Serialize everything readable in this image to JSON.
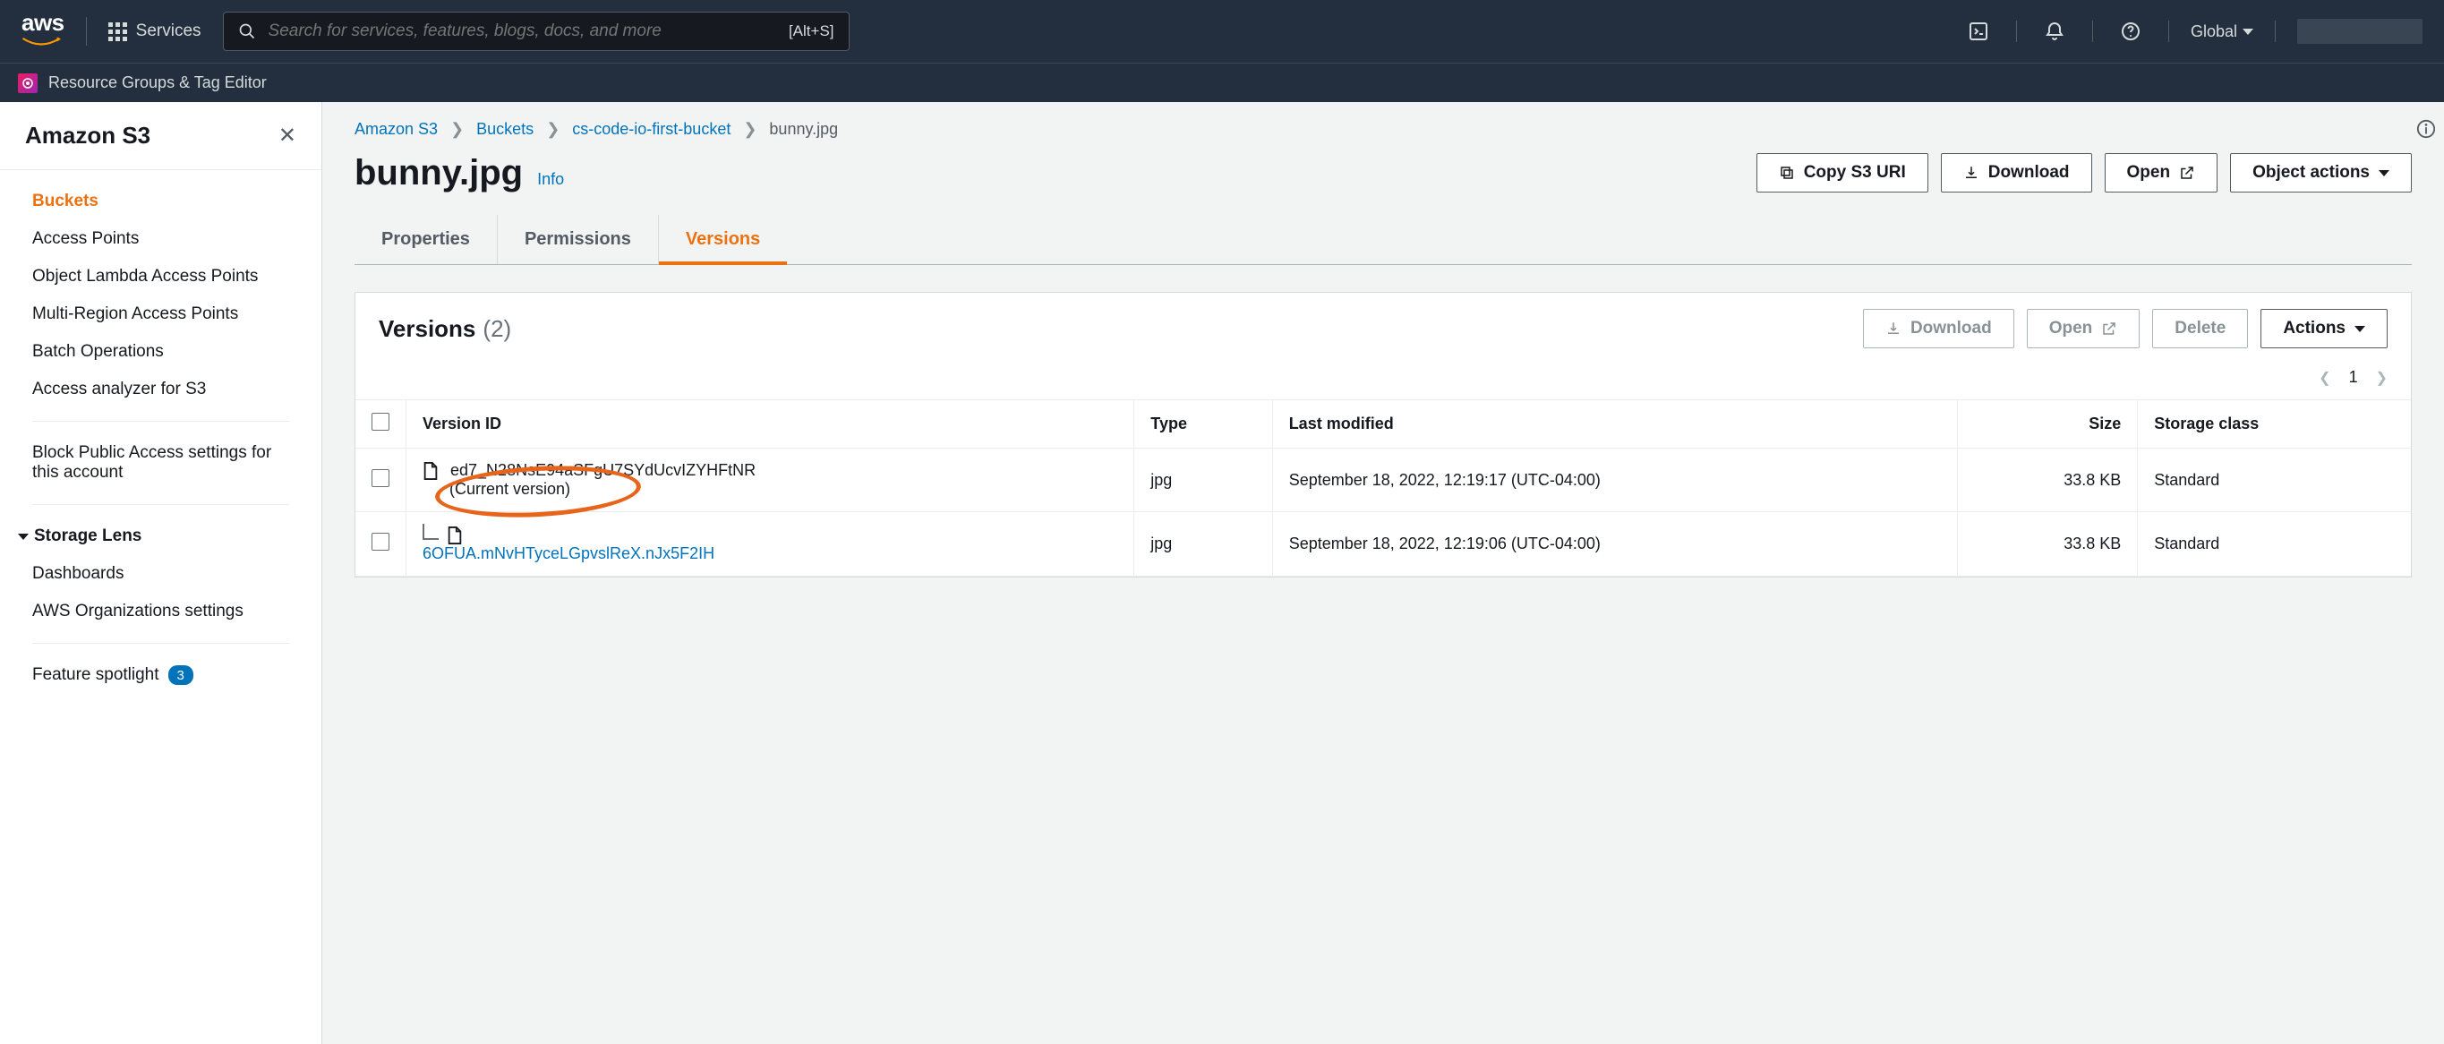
{
  "topnav": {
    "services_label": "Services",
    "search_placeholder": "Search for services, features, blogs, docs, and more",
    "search_kbd": "[Alt+S]",
    "region": "Global"
  },
  "subbar": {
    "label": "Resource Groups & Tag Editor"
  },
  "sidebar": {
    "title": "Amazon S3",
    "items": [
      {
        "label": "Buckets",
        "active": true
      },
      {
        "label": "Access Points"
      },
      {
        "label": "Object Lambda Access Points"
      },
      {
        "label": "Multi-Region Access Points"
      },
      {
        "label": "Batch Operations"
      },
      {
        "label": "Access analyzer for S3"
      }
    ],
    "block_public": "Block Public Access settings for this account",
    "storage_lens": "Storage Lens",
    "lens_items": [
      {
        "label": "Dashboards"
      },
      {
        "label": "AWS Organizations settings"
      }
    ],
    "feature_spotlight": "Feature spotlight",
    "feature_badge": "3"
  },
  "breadcrumb": {
    "items": [
      {
        "label": "Amazon S3",
        "link": true
      },
      {
        "label": "Buckets",
        "link": true
      },
      {
        "label": "cs-code-io-first-bucket",
        "link": true
      },
      {
        "label": "bunny.jpg",
        "link": false
      }
    ]
  },
  "page": {
    "title": "bunny.jpg",
    "info": "Info",
    "buttons": {
      "copy_uri": "Copy S3 URI",
      "download": "Download",
      "open": "Open",
      "object_actions": "Object actions"
    }
  },
  "tabs": [
    {
      "label": "Properties",
      "active": false
    },
    {
      "label": "Permissions",
      "active": false
    },
    {
      "label": "Versions",
      "active": true
    }
  ],
  "versions_panel": {
    "title": "Versions",
    "count": "(2)",
    "buttons": {
      "download": "Download",
      "open": "Open",
      "delete": "Delete",
      "actions": "Actions"
    },
    "page": "1",
    "columns": {
      "version_id": "Version ID",
      "type": "Type",
      "last_modified": "Last modified",
      "size": "Size",
      "storage_class": "Storage class"
    },
    "rows": [
      {
        "id": "ed7_N28NsE94aSFgU7SYdUcvIZYHFtNR",
        "current": "(Current version)",
        "type": "jpg",
        "modified": "September 18, 2022, 12:19:17 (UTC-04:00)",
        "size": "33.8 KB",
        "storage": "Standard",
        "is_current": true
      },
      {
        "id": "6OFUA.mNvHTyceLGpvslReX.nJx5F2IH",
        "type": "jpg",
        "modified": "September 18, 2022, 12:19:06 (UTC-04:00)",
        "size": "33.8 KB",
        "storage": "Standard",
        "is_current": false
      }
    ]
  }
}
